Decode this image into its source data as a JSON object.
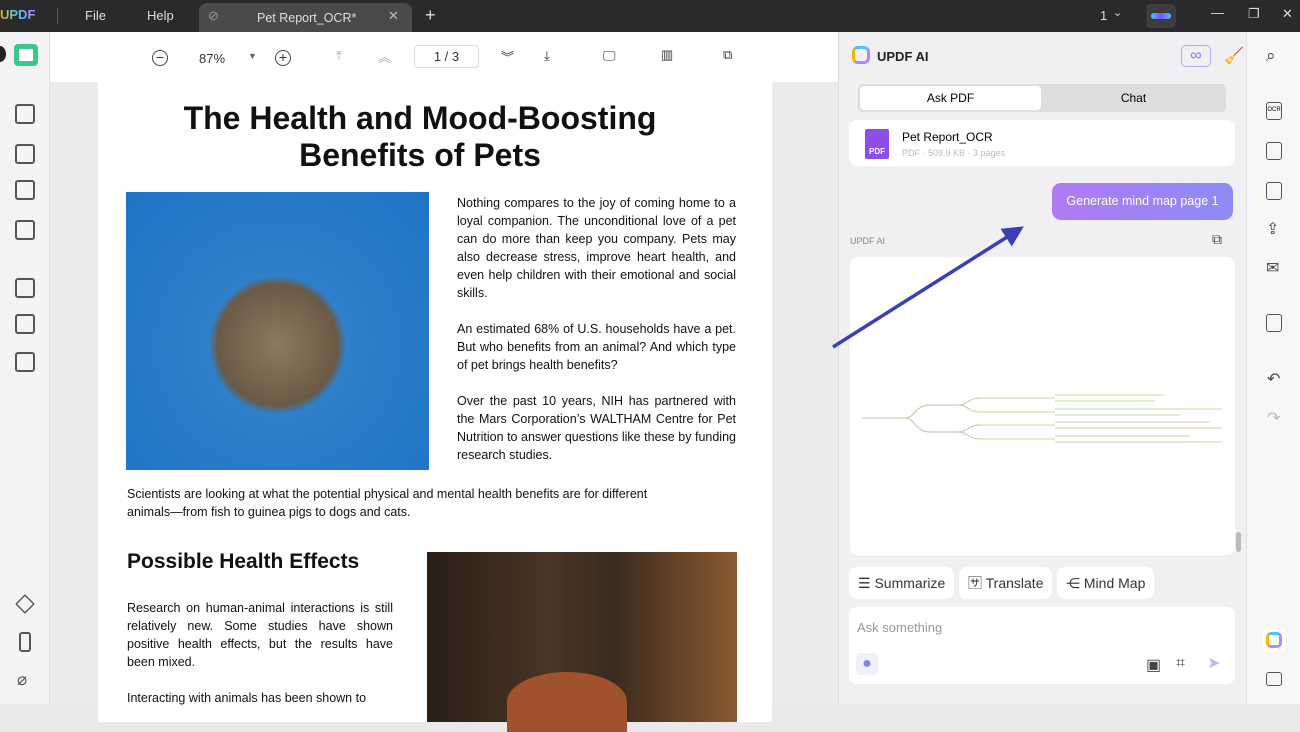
{
  "titlebar": {
    "logo": "UPDF",
    "menu": [
      "File",
      "Help"
    ],
    "tab_title": "Pet Report_OCR*",
    "new_tab": "+",
    "page_count_indicator": "1"
  },
  "toolbar": {
    "zoom": "87%",
    "page": "1 / 3"
  },
  "document": {
    "title": "The Health and Mood-Boosting Benefits of Pets",
    "paragraphs": [
      "Nothing compares to the joy of coming home to a loyal companion. The unconditional love of a pet can do more than keep you company. Pets may also decrease stress, improve heart health, and even help children with their emotional and social skills.",
      "An estimated 68% of U.S. households have a pet. But who benefits from an animal? And which type of pet brings health benefits?",
      "Over the past 10 years, NIH has partnered with the Mars Corporation’s WALTHAM Centre for Pet Nutrition to answer questions like these by funding research studies.",
      "Scientists are looking at what the potential physical and mental health benefits are for different animals—from fish to guinea pigs to dogs and cats."
    ],
    "section_heading": "Possible Health Effects",
    "section_paragraphs": [
      "Research on human-animal interactions is still relatively new. Some studies have shown positive health effects, but the results have been mixed.",
      "Interacting with animals has been shown to"
    ]
  },
  "ai": {
    "title": "UPDF AI",
    "tabs": [
      "Ask PDF",
      "Chat"
    ],
    "file_name": "Pet Report_OCR",
    "file_meta": "PDF · 509.9 KB · 3 pages",
    "file_badge": "PDF",
    "user_message": "Generate mind map page 1",
    "response_label": "UPDF AI",
    "chips": [
      "Summarize",
      "Translate",
      "Mind Map"
    ],
    "input_placeholder": "Ask something",
    "colors": {
      "accent": "#9a7af5",
      "arrow": "#3a3fb5"
    }
  }
}
